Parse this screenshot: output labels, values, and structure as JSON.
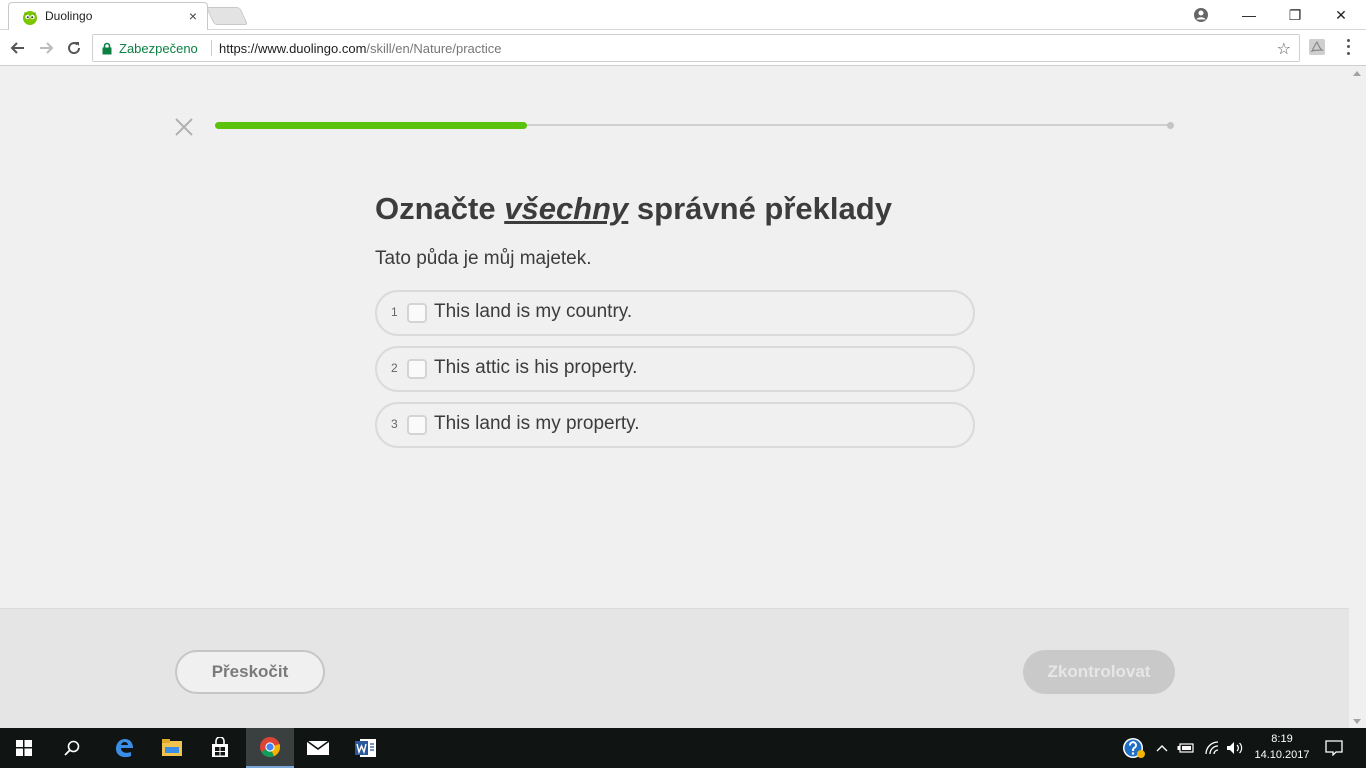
{
  "browser": {
    "tab_title": "Duolingo",
    "tab_close": "×",
    "window_controls": {
      "minimize": "—",
      "restore": "❐",
      "close": "✕"
    },
    "secure_label": "Zabezpečeno",
    "url_main": "https://www.duolingo.com",
    "url_path": "/skill/en/Nature/practice",
    "star": "☆"
  },
  "lesson": {
    "progress": 0.326,
    "heading_before": "Označte ",
    "heading_emph": "všechny",
    "heading_after": " správné překlady",
    "prompt": "Tato půda je můj majetek.",
    "options": [
      {
        "number": "1",
        "text": "This land is my country."
      },
      {
        "number": "2",
        "text": "This attic is his property."
      },
      {
        "number": "3",
        "text": "This land is my property."
      }
    ]
  },
  "footer": {
    "skip_label": "Přeskočit",
    "check_label": "Zkontrolovat"
  },
  "taskbar": {
    "icons": [
      "windows-start-icon",
      "search-icon",
      "edge-icon",
      "file-explorer-icon",
      "store-icon",
      "chrome-icon",
      "mail-icon",
      "word-icon"
    ],
    "time": "8:19",
    "date": "14.10.2017",
    "accent": "#5ac20c"
  }
}
